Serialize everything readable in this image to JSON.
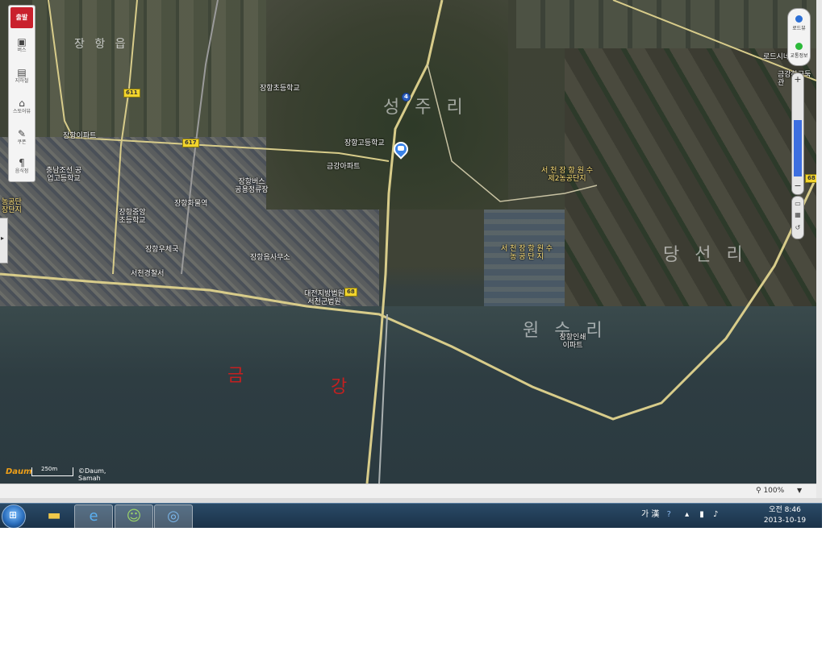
{
  "toolbar": {
    "start_label": "출발",
    "items": [
      {
        "icon": "bus-icon",
        "label": "버스"
      },
      {
        "icon": "subway-icon",
        "label": "지하철"
      },
      {
        "icon": "store-icon",
        "label": "스토어뷰"
      },
      {
        "icon": "coupon-icon",
        "label": "쿠폰"
      },
      {
        "icon": "restaurant-icon",
        "label": "음식점"
      }
    ]
  },
  "right_controls": {
    "roadview_label": "로드뷰",
    "traffic_label": "교통정보",
    "zoom_in": "+",
    "zoom_out": "−"
  },
  "map": {
    "area_labels": [
      "장 항 읍",
      "성 주 리",
      "당 선 리",
      "원 수 리",
      "서 천 장 항 원 수 제2농공단지",
      "서 천 장 항 원 수 농 공 단 지"
    ],
    "place_labels": [
      "장항초등학교",
      "장항고등학교",
      "금강아파트",
      "장항이파트",
      "충남조선 공업고등학교",
      "장항버스 공용정류장",
      "장항화물역",
      "장항중앙 초등학교",
      "장항우체국",
      "장항읍사무소",
      "서천경찰서",
      "대전지방법원 서천군법원",
      "농공단 장단지",
      "장항인쇄 이파트",
      "로드시네",
      "금강하구둑 관"
    ],
    "road_numbers": [
      "611",
      "617",
      "68",
      "4",
      "68"
    ],
    "handwritten": [
      "금",
      "강"
    ],
    "accent_color": "#3a83e8"
  },
  "scale": {
    "logo": "Daum",
    "distance": "250m",
    "copyright": "©Daum, Samah"
  },
  "statusbar": {
    "zoom": "100%"
  },
  "taskbar": {
    "ime": "가 漢",
    "clock_time": "오전 8:46",
    "clock_date": "2013-10-19"
  }
}
